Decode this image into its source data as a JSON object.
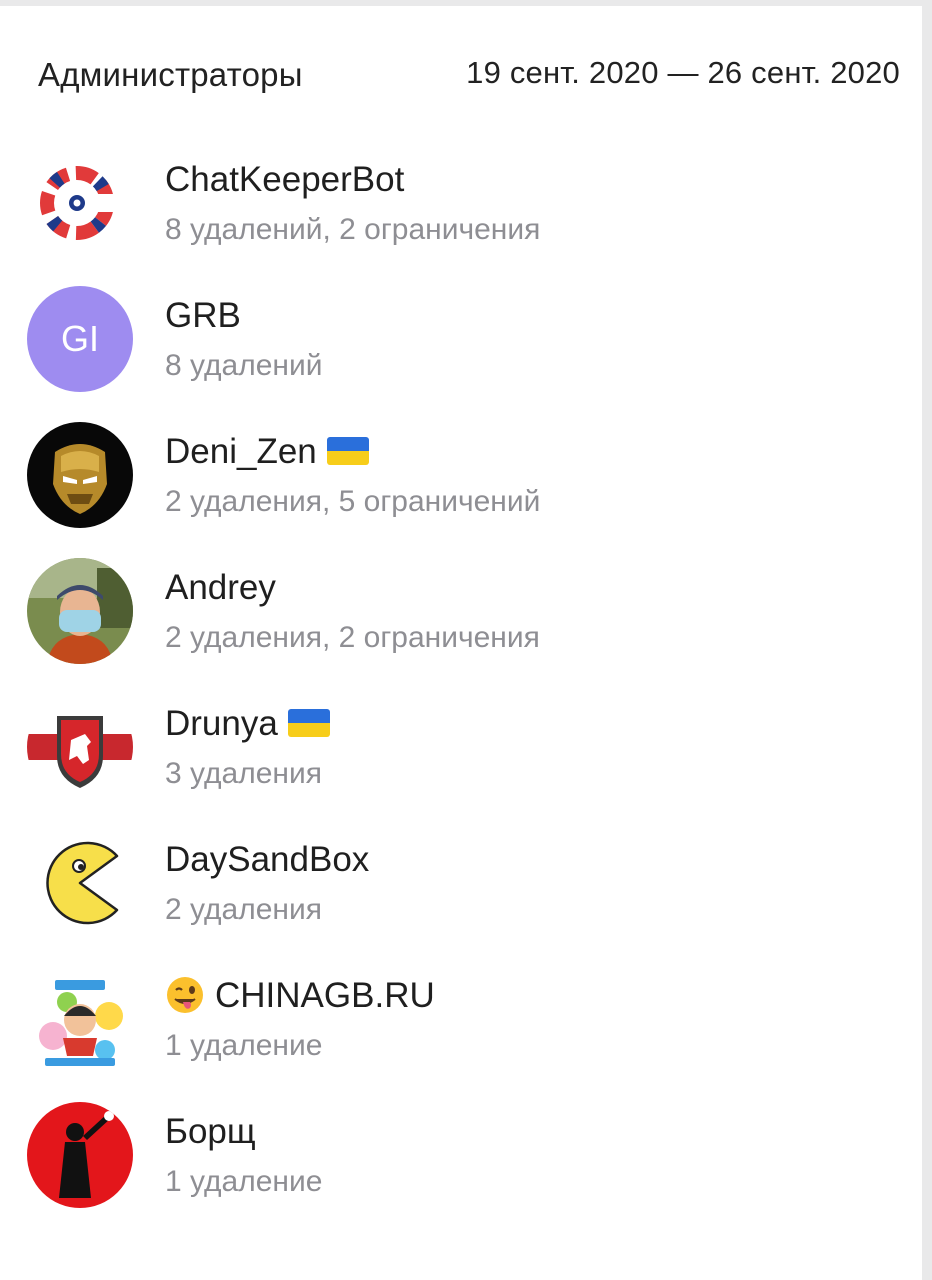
{
  "header": {
    "title": "Администраторы",
    "date_range": "19 сент. 2020 — 26 сент. 2020"
  },
  "admins": [
    {
      "name": "ChatKeeperBot",
      "stats": "8 удалений, 2 ограничения",
      "avatar": "chatkeeper-logo"
    },
    {
      "name": "GRB",
      "stats": "8 удалений",
      "avatar": "initials",
      "initials": "GI",
      "avatar_color": "#9e8cf0"
    },
    {
      "name": "Deni_Zen",
      "stats": "2 удаления, 5 ограничений",
      "avatar": "ironman-photo",
      "flag": "ukraine"
    },
    {
      "name": "Andrey",
      "stats": "2 удаления, 2 ограничения",
      "avatar": "person-photo"
    },
    {
      "name": "Drunya",
      "stats": "3 удаления",
      "avatar": "coat-of-arms",
      "flag": "ukraine"
    },
    {
      "name": "DaySandBox",
      "stats": "2 удаления",
      "avatar": "pacman"
    },
    {
      "name": "CHINAGB.RU",
      "stats": "1 удаление",
      "avatar": "chinagb-logo",
      "emoji": "winking-tongue-emoji"
    },
    {
      "name": "Борщ",
      "stats": "1 удаление",
      "avatar": "red-silhouette"
    }
  ]
}
